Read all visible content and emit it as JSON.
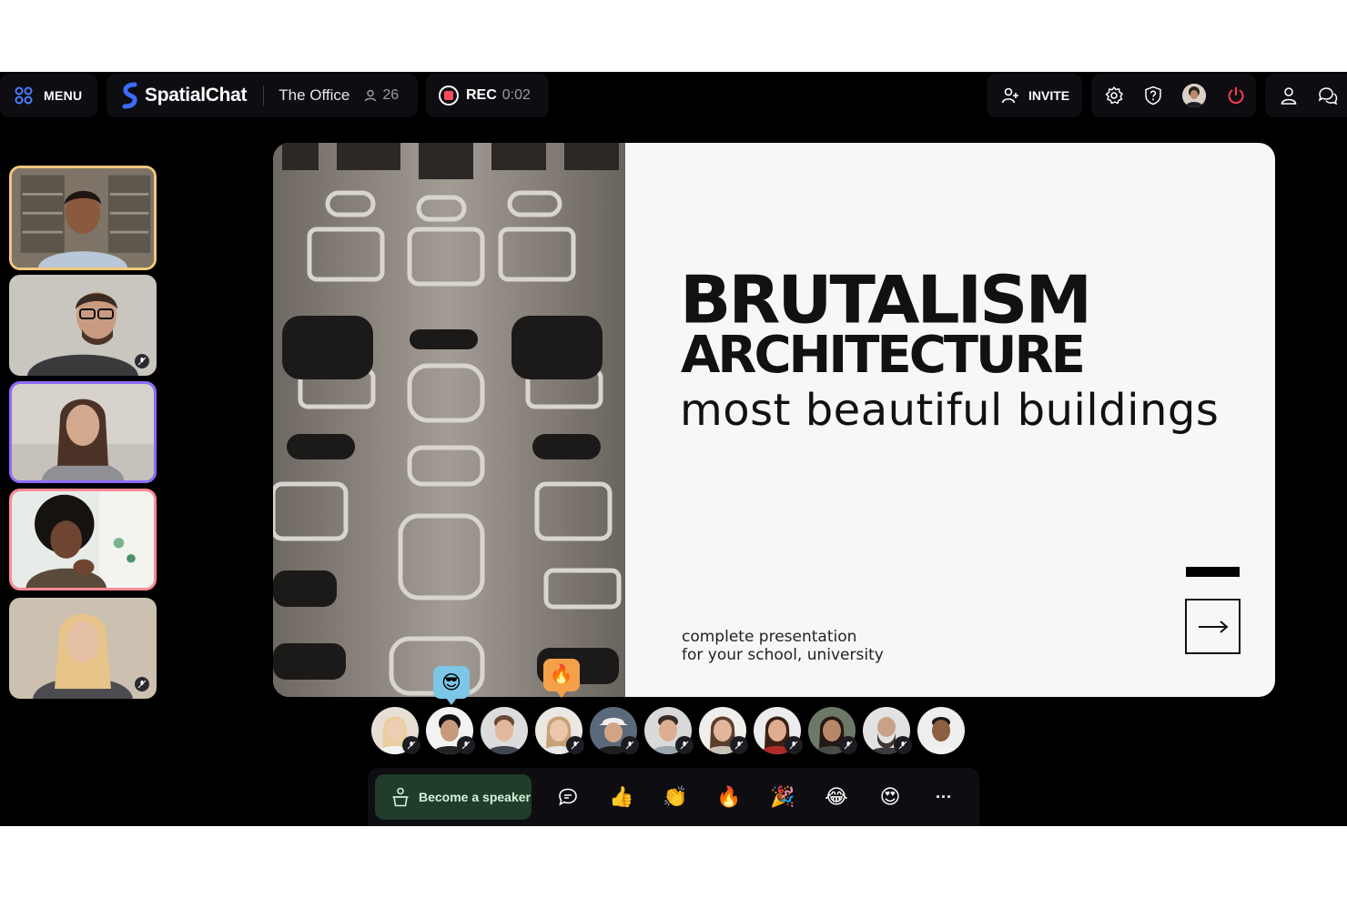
{
  "topbar": {
    "menu_label": "MENU",
    "brand": "SpatialChat",
    "room_name": "The Office",
    "participant_count": "26",
    "rec_label": "REC",
    "rec_time": "0:02",
    "invite_label": "INVITE"
  },
  "icons": {
    "menu": "grid-icon",
    "participants": "person-icon",
    "settings": "gear-icon",
    "help": "help-icon",
    "leave": "power-icon",
    "profile": "user-icon",
    "chat": "chat-bubbles-icon"
  },
  "colors": {
    "brand_accent": "#3d6bff",
    "rec_red": "#ff4a5c",
    "leave_red": "#ff3b4e",
    "speaker_green_bg": "#1f3d2a",
    "tile1_border": "#f0c87a",
    "tile3_border": "#8b6cff",
    "tile4_border": "#ff8a96"
  },
  "slide": {
    "title_line1": "BRUTALISM",
    "title_line2": "ARCHITECTURE",
    "title_line3": "most beautiful buildings",
    "caption_line1": "complete presentation",
    "caption_line2": "for your school, university",
    "next_arrow": "→"
  },
  "floating_reactions": [
    "😎",
    "🔥"
  ],
  "bottom_bar": {
    "speaker_button": "Become a speaker",
    "reactions": [
      "👍",
      "👏",
      "🔥",
      "🎉",
      "😂",
      "😍"
    ],
    "more": "···"
  }
}
